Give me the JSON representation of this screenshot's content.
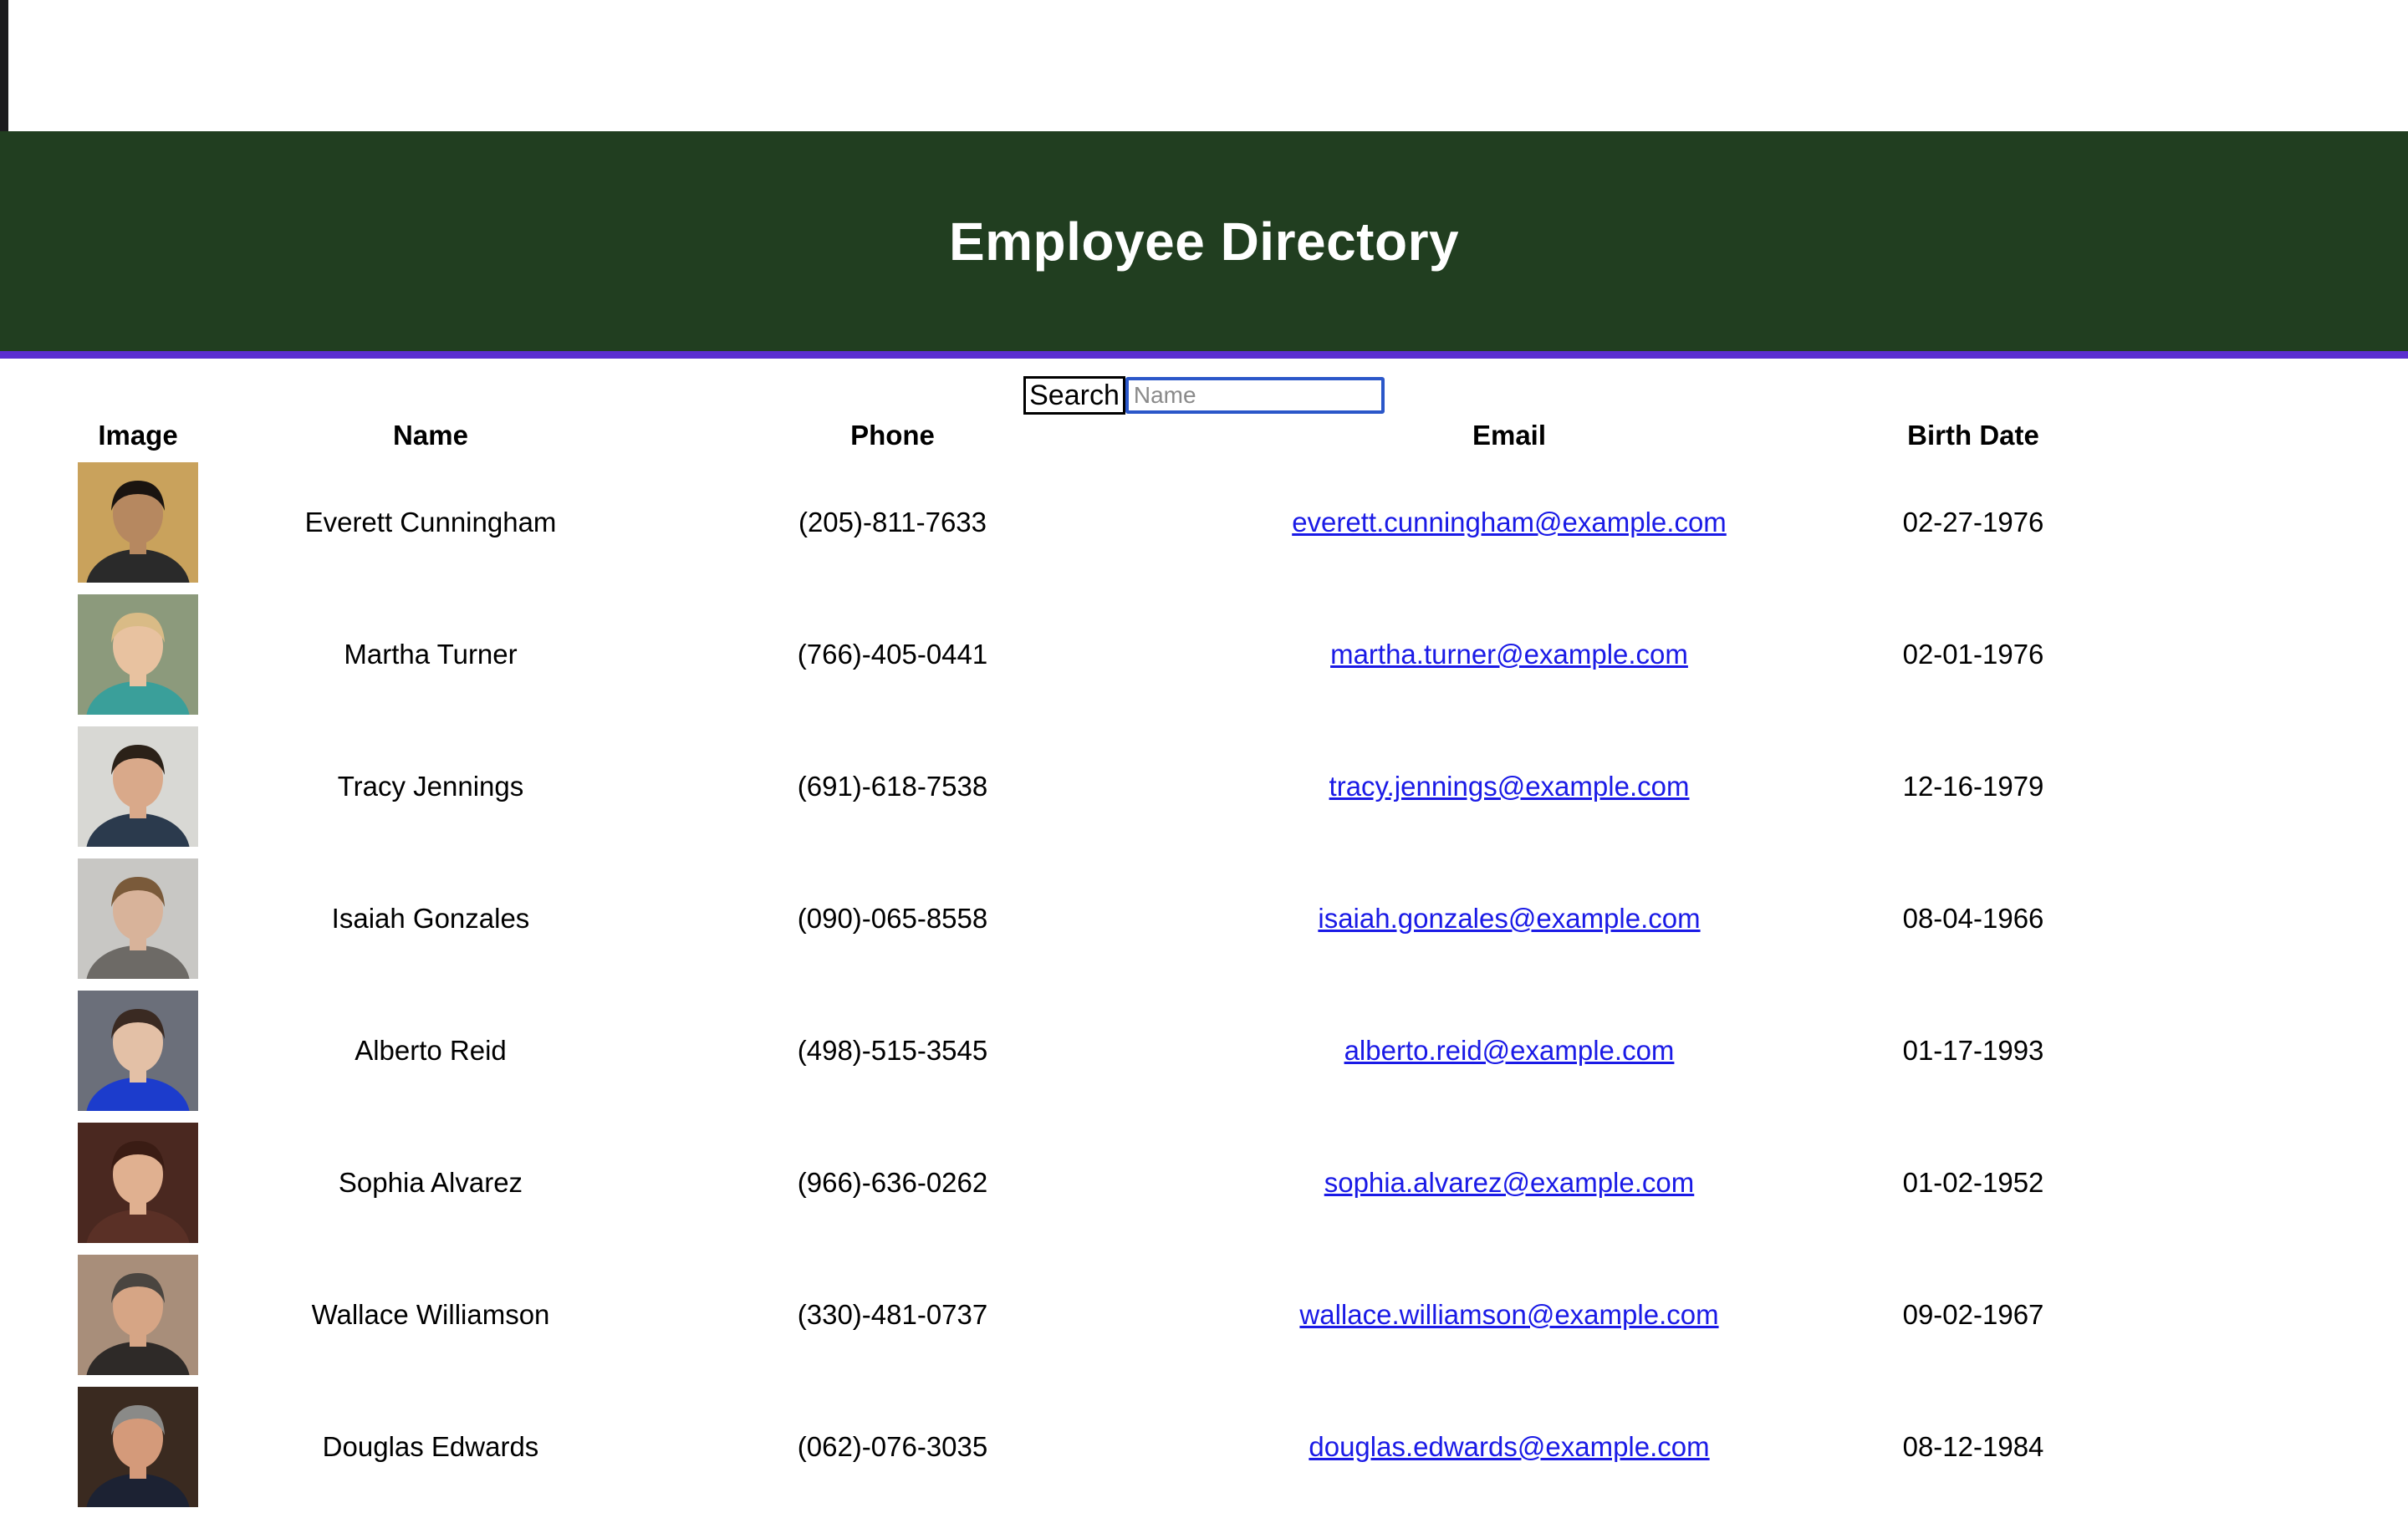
{
  "header": {
    "title": "Employee Directory"
  },
  "search": {
    "label": "Search",
    "placeholder": "Name",
    "value": ""
  },
  "table": {
    "columns": [
      "Image",
      "Name",
      "Phone",
      "Email",
      "Birth Date"
    ],
    "rows": [
      {
        "name": "Everett Cunningham",
        "phone": "(205)-811-7633",
        "email": "everett.cunningham@example.com",
        "birth_date": "02-27-1976",
        "photo": {
          "bg": "#c9a25c",
          "skin": "#b68860",
          "hair": "#1a1410",
          "shirt": "#2a2a2a"
        }
      },
      {
        "name": "Martha Turner",
        "phone": "(766)-405-0441",
        "email": "martha.turner@example.com",
        "birth_date": "02-01-1976",
        "photo": {
          "bg": "#8c9a7c",
          "skin": "#e8c2a0",
          "hair": "#d9bb86",
          "shirt": "#3a9f9a"
        }
      },
      {
        "name": "Tracy Jennings",
        "phone": "(691)-618-7538",
        "email": "tracy.jennings@example.com",
        "birth_date": "12-16-1979",
        "photo": {
          "bg": "#d8d8d4",
          "skin": "#d9a98a",
          "hair": "#2b2118",
          "shirt": "#2b3a4d"
        }
      },
      {
        "name": "Isaiah Gonzales",
        "phone": "(090)-065-8558",
        "email": "isaiah.gonzales@example.com",
        "birth_date": "08-04-1966",
        "photo": {
          "bg": "#c8c7c4",
          "skin": "#d8b39a",
          "hair": "#7a5a3a",
          "shirt": "#6d6a66"
        }
      },
      {
        "name": "Alberto Reid",
        "phone": "(498)-515-3545",
        "email": "alberto.reid@example.com",
        "birth_date": "01-17-1993",
        "photo": {
          "bg": "#6b6f7a",
          "skin": "#e3c0a6",
          "hair": "#3a2a22",
          "shirt": "#1c3ccc"
        }
      },
      {
        "name": "Sophia Alvarez",
        "phone": "(966)-636-0262",
        "email": "sophia.alvarez@example.com",
        "birth_date": "01-02-1952",
        "photo": {
          "bg": "#4a2820",
          "skin": "#e0b090",
          "hair": "#3a1c14",
          "shirt": "#5a3026"
        }
      },
      {
        "name": "Wallace Williamson",
        "phone": "(330)-481-0737",
        "email": "wallace.williamson@example.com",
        "birth_date": "09-02-1967",
        "photo": {
          "bg": "#a88e7a",
          "skin": "#d6a585",
          "hair": "#4a4540",
          "shirt": "#2e2a28"
        }
      },
      {
        "name": "Douglas Edwards",
        "phone": "(062)-076-3035",
        "email": "douglas.edwards@example.com",
        "birth_date": "08-12-1984",
        "photo": {
          "bg": "#3a2a20",
          "skin": "#d49a7a",
          "hair": "#8a8a88",
          "shirt": "#1c2233"
        }
      }
    ]
  },
  "colors": {
    "header_bg": "#213e20",
    "header_border": "#5b2fd0",
    "link": "#1a1ae6",
    "search_border": "#2b57c9"
  }
}
